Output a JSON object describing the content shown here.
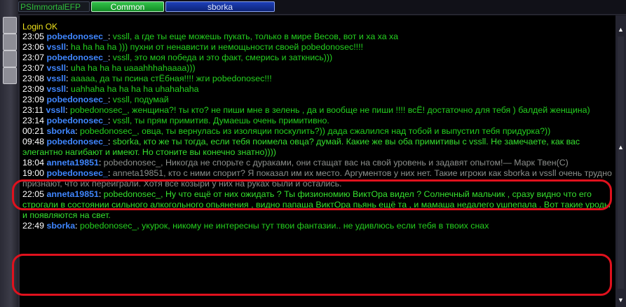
{
  "tabs": [
    {
      "label": "PSImmortalEFP"
    },
    {
      "label": "Common"
    },
    {
      "label": "sborka"
    }
  ],
  "status": {
    "login": "Login OK"
  },
  "messages": [
    {
      "time": "23:05",
      "nick": "pobedonosec_",
      "text": "vssll, а где ты еще можешь пукать, только в мире Весов, вот и ха ха ха"
    },
    {
      "time": "23:06",
      "nick": "vssll",
      "text": "ha ha ha ha ))) пухни от ненависти и немощьности своей pobedonosec!!!!"
    },
    {
      "time": "23:07",
      "nick": "pobedonosec_",
      "text": "vssll, это моя победа и это факт, смерись и заткнись)))"
    },
    {
      "time": "23:07",
      "nick": "vssll",
      "text": "uha ha ha ha  uaaahhhahaaaa)))"
    },
    {
      "time": "23:08",
      "nick": "vssll",
      "text": "ааааа, да ты псина стЁбная!!!!  жги pobedonosec!!!"
    },
    {
      "time": "23:09",
      "nick": "vssll",
      "text": "uahhaha ha ha ha ha uhahahaha"
    },
    {
      "time": "23:09",
      "nick": "pobedonosec_",
      "text": "vssll, подумай"
    },
    {
      "time": "23:11",
      "nick": "vssll",
      "text": "pobedonosec_, женщина?! ты кто? не пиши мне в зелень , да и вообще не пиши !!!! всЁ! достаточно для тебя ) балдей женщина)"
    },
    {
      "time": "23:14",
      "nick": "pobedonosec_",
      "text": "vssll, ты прям примитив. Думаешь очень примитивно."
    },
    {
      "time": "00:21",
      "nick": "sborka",
      "text": "pobedonosec_, овца, ты вернулась из изоляции поскулить?)) дада сжалился над тобой и выпустил тебя придурка?))"
    },
    {
      "time": "09:48",
      "nick": "pobedonosec_",
      "text": "sborka, кто же ты тогда,  если тебя поимела овца? думай. Какие же вы оба примитивы с vssll. Не замечаете, как вас элегантно нагибают и имеют. Но стоните вы конечно знатно))))"
    },
    {
      "time": "18:04",
      "nick": "anneta19851",
      "text": "pobedonosec_, Никогда не спорьте с дураками, они стащат вас на свой уровень и задавят опытом!— Марк Твен(С)"
    },
    {
      "time": "19:00",
      "nick": "pobedonosec_",
      "text": "anneta19851, кто с ними спорит? Я показал им их место. Аргументов у них нет. Такие игроки как sborka и vssll очень трудно признают, что их переиграли. Хотя все козыри у них на руках были и остались."
    },
    {
      "time": "22:05",
      "nick": "anneta19851",
      "text": "pobedonosec_, Ну что ещё от них ожидать ? Ты физиономию ВиктОра видел ? Солнечный мальчик , сразу видно что его строгали в состоянии сильного алкогольного  опьянения , видно папаша ВиктОра пьянь ещё та  , и мамаша недалего ушпепала . Вот такие уроды и появляются на свет."
    },
    {
      "time": "22:49",
      "nick": "sborka",
      "text": "pobedonosec_, укурок, никому не интересны тут твои фантазии.. не удивлюсь если тебя в твоих снах"
    }
  ],
  "colors": {
    "highlight": "#e0111d",
    "nick": "#3f86ff",
    "text": "#24d01f",
    "login": "#f0e41c"
  }
}
